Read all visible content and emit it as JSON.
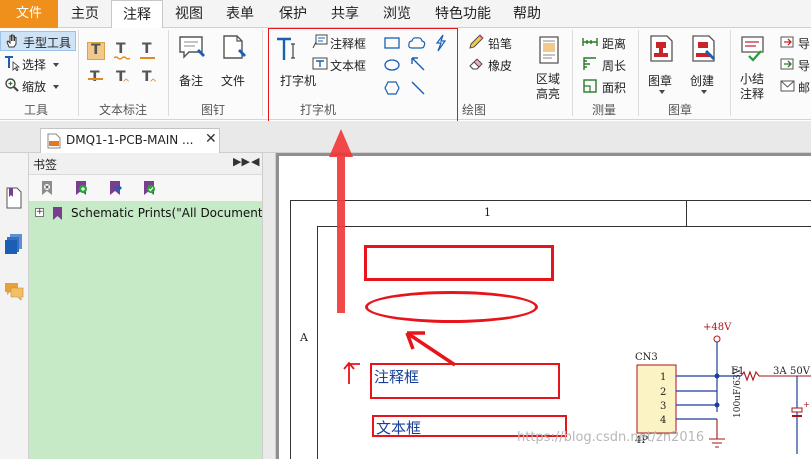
{
  "menu": {
    "file": "文件",
    "tabs": [
      "主页",
      "注释",
      "视图",
      "表单",
      "保护",
      "共享",
      "浏览",
      "特色功能",
      "帮助"
    ],
    "active_tab": "注释"
  },
  "ribbon": {
    "tools_group": {
      "hand": "手型工具",
      "select": "选择",
      "zoom": "缩放",
      "label": "工具"
    },
    "text_markup_group": {
      "label": "文本标注"
    },
    "pin_group": {
      "note": "备注",
      "file": "文件",
      "label": "图钉"
    },
    "typewriter_group": {
      "typewriter": "打字机",
      "callout": "注释框",
      "textbox": "文本框",
      "label": "打字机"
    },
    "drawing_group": {
      "pencil": "铅笔",
      "eraser": "橡皮",
      "area": "区域高亮",
      "label": "绘图"
    },
    "measure_group": {
      "distance": "距离",
      "perimeter": "周长",
      "area": "面积",
      "label": "测量"
    },
    "stamp_group": {
      "stamp": "图章",
      "create": "创建",
      "label": "图章"
    },
    "summary_group": {
      "summary": "小结注释",
      "import": "导",
      "export": "导",
      "email": "邮"
    }
  },
  "doc_tab": {
    "title": "DMQ1-1-PCB-MAIN ..."
  },
  "bookmarks": {
    "title": "书签",
    "item": "Schematic Prints(\"All Documents\",I"
  },
  "schematic": {
    "zone_number": "1",
    "zone_letter": "A",
    "annotations": {
      "callout": "注释框",
      "textbox": "文本框"
    },
    "voltage": "+48V",
    "connector_ref": "CN3",
    "connector_pins": [
      "1",
      "2",
      "3",
      "4"
    ],
    "connector_value": "4P",
    "fuse_ref": "F1",
    "fuse_value": "3A",
    "voltage2": "50V",
    "cap_value": "100uF/63V",
    "watermark": "https://blog.csdn.net/zn2016"
  },
  "colors": {
    "file_tab": "#f0901c",
    "highlight": "#e8141c",
    "bookmark_bg": "#c6e9c6",
    "schematic_red": "#a8161a",
    "schematic_blue": "#1a3f9a"
  }
}
